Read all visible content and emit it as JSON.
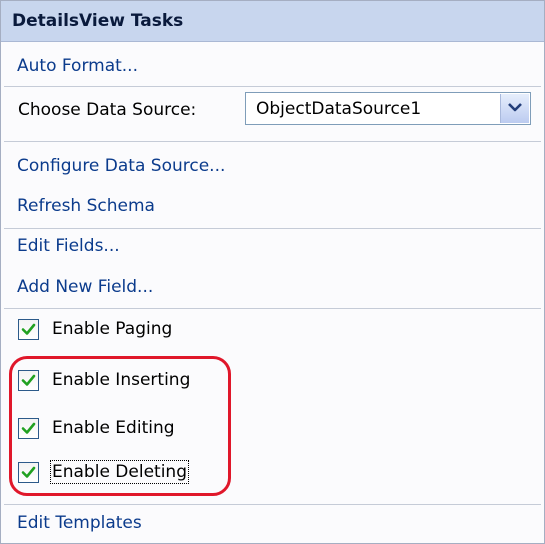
{
  "panel": {
    "title": "DetailsView Tasks"
  },
  "actions": {
    "auto_format": "Auto Format...",
    "configure_data_source": "Configure Data Source...",
    "refresh_schema": "Refresh Schema",
    "edit_fields": "Edit Fields...",
    "add_new_field": "Add New Field...",
    "edit_templates": "Edit Templates"
  },
  "data_source": {
    "label": "Choose Data Source:",
    "selected": "ObjectDataSource1"
  },
  "options": {
    "paging": {
      "label": "Enable Paging",
      "checked": true
    },
    "inserting": {
      "label": "Enable Inserting",
      "checked": true
    },
    "editing": {
      "label": "Enable Editing",
      "checked": true
    },
    "deleting": {
      "label": "Enable Deleting",
      "checked": true
    }
  },
  "colors": {
    "header_bg": "#c8d6ee",
    "link": "#0b3b8c",
    "check": "#21a121",
    "highlight": "#e0172a"
  }
}
